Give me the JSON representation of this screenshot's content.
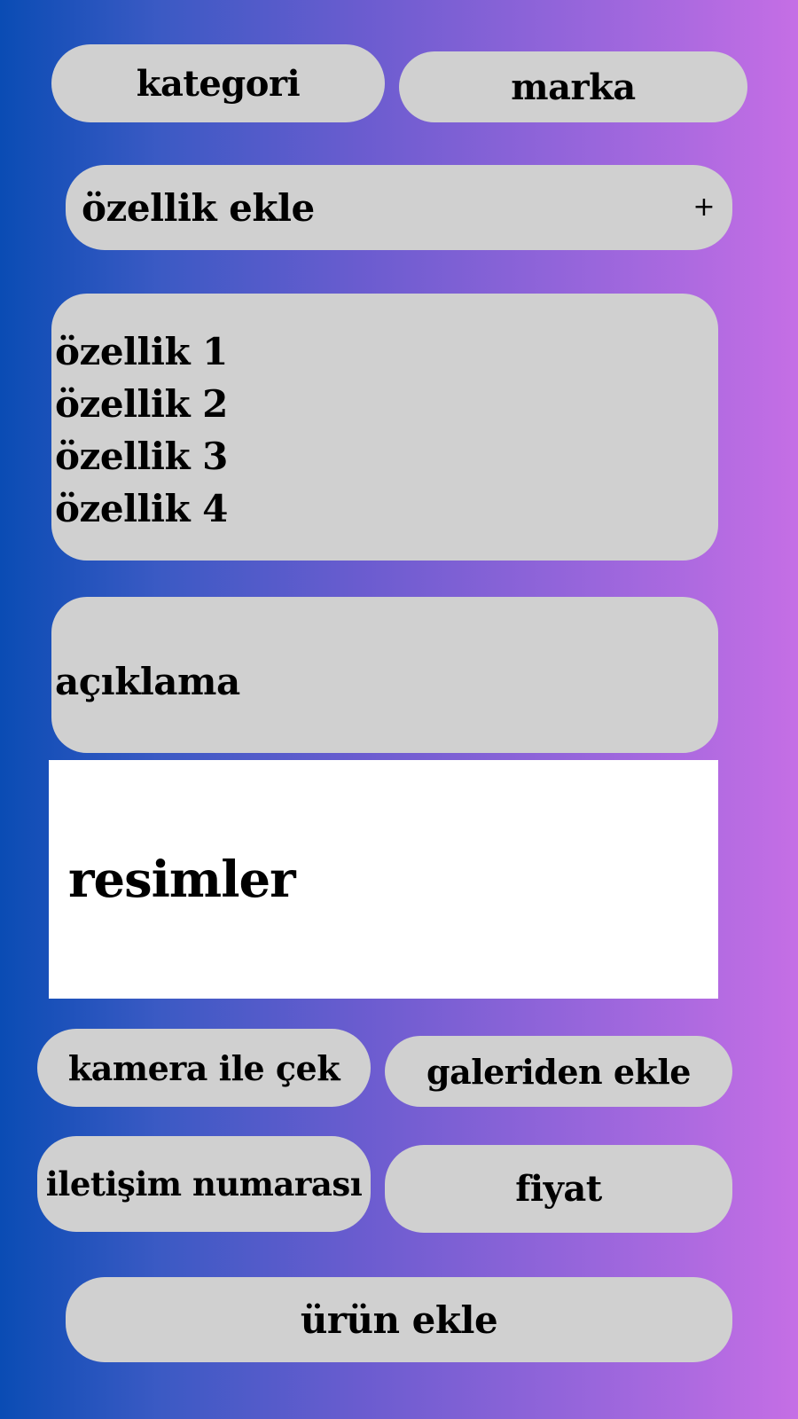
{
  "colors": {
    "gradient_start": "#0a4cb4",
    "gradient_end": "#c56ee5",
    "pill_background": "#d0d0d0",
    "images_background": "#ffffff"
  },
  "top_buttons": {
    "category_label": "kategori",
    "brand_label": "marka"
  },
  "feature_add": {
    "label": "özellik ekle",
    "icon": "plus-icon",
    "icon_glyph": "+"
  },
  "features": [
    "özellik 1",
    "özellik 2",
    "özellik 3",
    "özellik 4"
  ],
  "description": {
    "label": "açıklama"
  },
  "images": {
    "label": "resimler"
  },
  "image_buttons": {
    "camera_label": "kamera ile çek",
    "gallery_label": "galeriden ekle"
  },
  "contact": {
    "phone_label": "iletişim numarası",
    "price_label": "fiyat"
  },
  "submit": {
    "label": "ürün ekle"
  }
}
